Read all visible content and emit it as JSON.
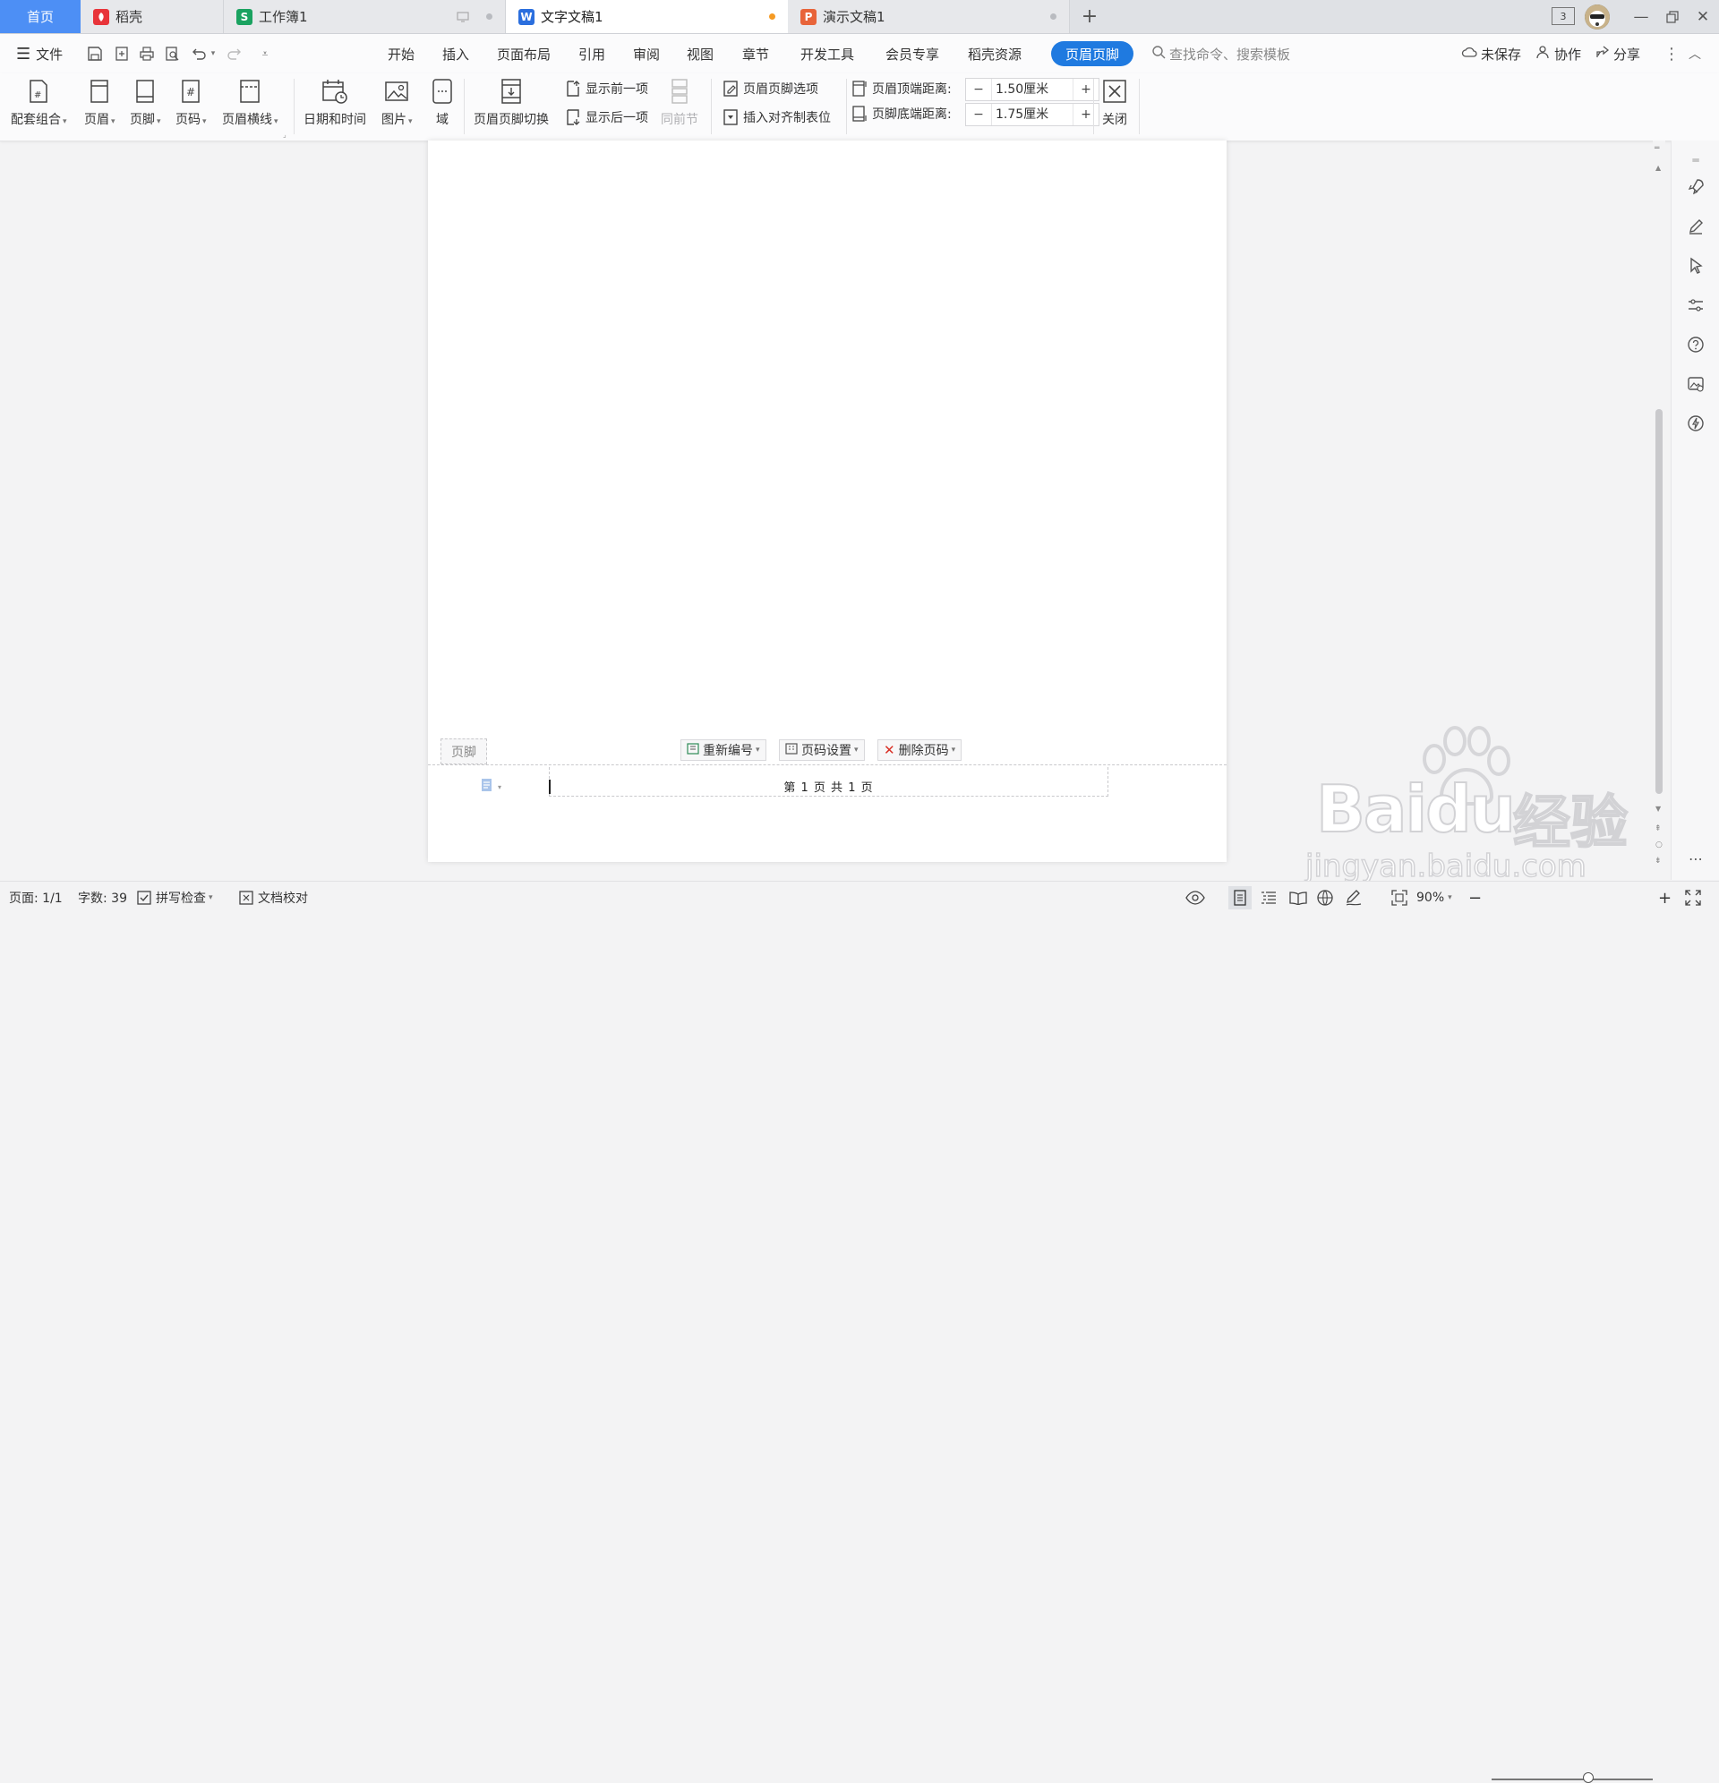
{
  "tabs": [
    {
      "label": "首页",
      "color": "#4d8ff5"
    },
    {
      "label": "稻壳",
      "color": "#e8343a"
    },
    {
      "label": "工作簿1",
      "color": "#1aa260"
    },
    {
      "label": "文字文稿1",
      "color": "#2b6fde"
    },
    {
      "label": "演示文稿1",
      "color": "#e8643a"
    }
  ],
  "tabs_extra": {
    "badge": "3",
    "unsaved_dot_color": "#f59a23"
  },
  "menu": {
    "file": "文件",
    "items": [
      "开始",
      "插入",
      "页面布局",
      "引用",
      "审阅",
      "视图",
      "章节",
      "开发工具",
      "会员专享",
      "稻壳资源",
      "页眉页脚"
    ],
    "search_placeholder": "查找命令、搜索模板",
    "unsaved": "未保存",
    "collaborate": "协作",
    "share": "分享"
  },
  "ribbon": {
    "combo": "配套组合",
    "header": "页眉",
    "footer": "页脚",
    "page_number": "页码",
    "header_line": "页眉横线",
    "date_time": "日期和时间",
    "picture": "图片",
    "field": "域",
    "switch": "页眉页脚切换",
    "show_prev": "显示前一项",
    "show_next": "显示后一项",
    "same_as_prev": "同前节",
    "hf_options": "页眉页脚选项",
    "insert_align_tab": "插入对齐制表位",
    "header_top_label": "页眉顶端距离:",
    "header_top_value": "1.50厘米",
    "footer_bottom_label": "页脚底端距离:",
    "footer_bottom_value": "1.75厘米",
    "close": "关闭"
  },
  "document": {
    "footer_tag": "页脚",
    "renumber": "重新编号",
    "page_setup": "页码设置",
    "delete_page_number": "删除页码",
    "page_number_text": "第 1 页 共 1 页"
  },
  "status": {
    "page": "页面: 1/1",
    "words": "字数: 39",
    "spell_check": "拼写检查",
    "doc_proof": "文档校对",
    "zoom": "90%",
    "zoom_fraction": 0.6
  },
  "watermark": {
    "brand": "Baidu",
    "cn": "经验",
    "url": "jingyan.baidu.com"
  }
}
